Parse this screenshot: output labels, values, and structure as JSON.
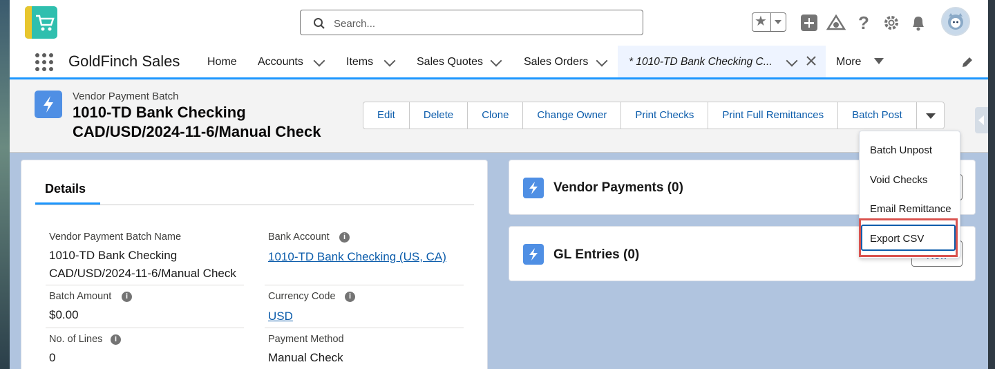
{
  "header": {
    "search_placeholder": "Search...",
    "help_glyph": "?"
  },
  "nav": {
    "app_name": "GoldFinch Sales",
    "items": [
      {
        "label": "Home"
      },
      {
        "label": "Accounts"
      },
      {
        "label": "Items"
      },
      {
        "label": "Sales Quotes"
      },
      {
        "label": "Sales Orders"
      }
    ],
    "active_tab": "* 1010-TD Bank Checking C...",
    "more_label": "More"
  },
  "record": {
    "object_type": "Vendor Payment Batch",
    "title_line1": "1010-TD Bank Checking",
    "title_line2": "CAD/USD/2024-11-6/Manual Check",
    "actions": [
      "Edit",
      "Delete",
      "Clone",
      "Change Owner",
      "Print Checks",
      "Print Full Remittances",
      "Batch Post"
    ]
  },
  "details": {
    "tab_label": "Details",
    "fields": {
      "batch_name_label": "Vendor Payment Batch Name",
      "batch_name_line1": "1010-TD Bank Checking",
      "batch_name_line2": "CAD/USD/2024-11-6/Manual Check",
      "bank_account_label": "Bank Account",
      "bank_account_value": "1010-TD Bank Checking (US, CA)",
      "batch_amount_label": "Batch Amount",
      "batch_amount_value": "$0.00",
      "currency_label": "Currency Code",
      "currency_value": "USD",
      "lines_label": "No. of Lines",
      "lines_value": "0",
      "payment_method_label": "Payment Method",
      "payment_method_value": "Manual Check"
    }
  },
  "related": {
    "vendor_payments_title": "Vendor Payments (0)",
    "gl_entries_title": "GL Entries (0)",
    "gl_new_partial": "New"
  },
  "menu": {
    "items": [
      "Batch Unpost",
      "Void Checks",
      "Email Remittance",
      "Export CSV"
    ]
  },
  "colors": {
    "brand_blue": "#1b96ff",
    "link_blue": "#0b5cab",
    "record_icon": "#4f8fe4",
    "highlight_red": "#d9534f"
  },
  "icons": [
    "search-icon",
    "favorites-star-icon",
    "add-icon",
    "trailhead-icon",
    "help-icon",
    "setup-gear-icon",
    "notification-bell-icon",
    "app-launcher-icon",
    "edit-pencil-icon",
    "lightning-icon",
    "info-icon",
    "close-icon"
  ]
}
